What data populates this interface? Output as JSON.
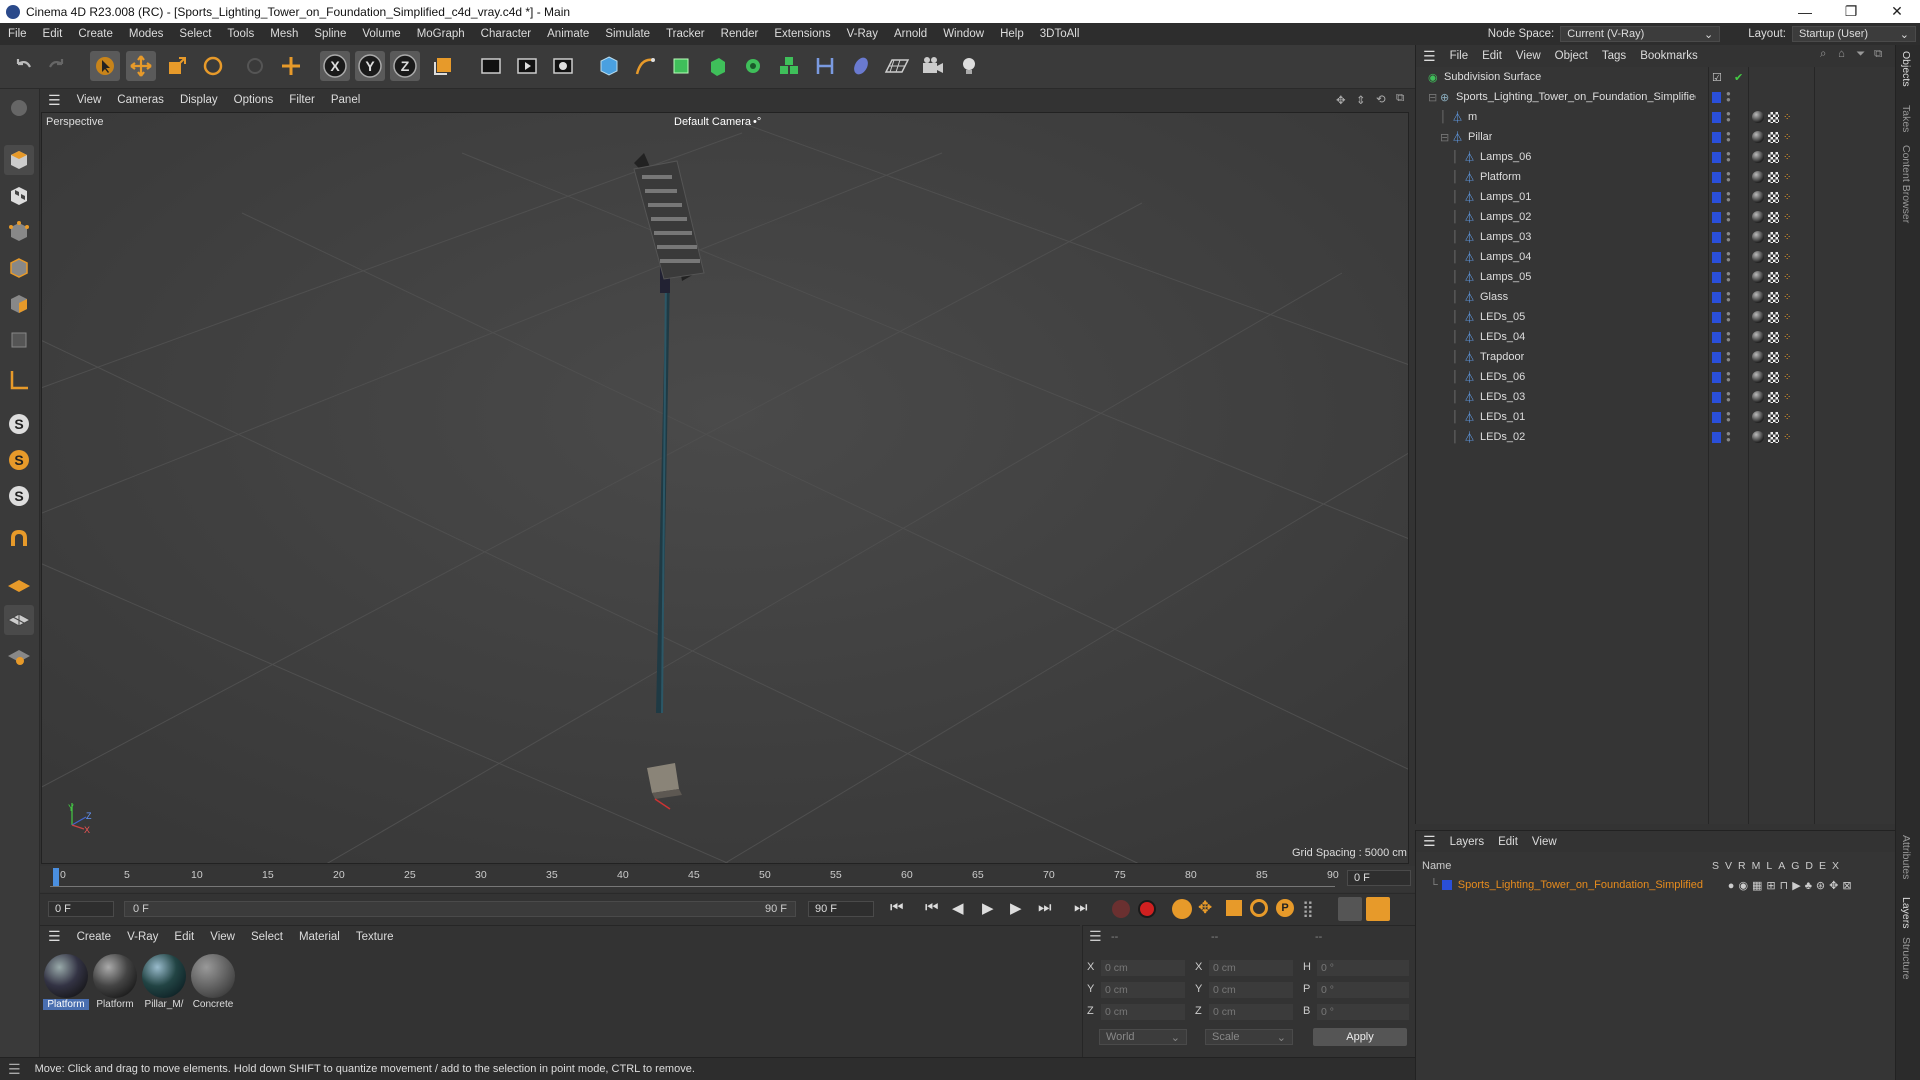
{
  "window": {
    "title": "Cinema 4D R23.008 (RC) - [Sports_Lighting_Tower_on_Foundation_Simplified_c4d_vray.c4d *] - Main",
    "minimize": "—",
    "maximize": "❐",
    "close": "✕"
  },
  "menubar": {
    "items": [
      "File",
      "Edit",
      "Create",
      "Modes",
      "Select",
      "Tools",
      "Mesh",
      "Spline",
      "Volume",
      "MoGraph",
      "Character",
      "Animate",
      "Simulate",
      "Tracker",
      "Render",
      "Extensions",
      "V-Ray",
      "Arnold",
      "Window",
      "Help",
      "3DToAll"
    ],
    "node_space_label": "Node Space:",
    "node_space_value": "Current (V-Ray)",
    "layout_label": "Layout:",
    "layout_value": "Startup (User)"
  },
  "viewport": {
    "menu": [
      "View",
      "Cameras",
      "Display",
      "Options",
      "Filter",
      "Panel"
    ],
    "view_name": "Perspective",
    "camera": "Default Camera",
    "camera_suffix": "•°",
    "grid_spacing": "Grid Spacing : 5000 cm",
    "axis_y": "Y",
    "axis_z": "Z",
    "axis_x": "X"
  },
  "timeline": {
    "ticks": [
      "0",
      "5",
      "10",
      "15",
      "20",
      "25",
      "30",
      "35",
      "40",
      "45",
      "50",
      "55",
      "60",
      "65",
      "70",
      "75",
      "80",
      "85",
      "90"
    ],
    "current_frame": "0 F",
    "start_field": "0 F",
    "range_start": "0 F",
    "range_end": "90 F",
    "end_field": "90 F"
  },
  "material_manager": {
    "menu": [
      "Create",
      "V-Ray",
      "Edit",
      "View",
      "Select",
      "Material",
      "Texture"
    ],
    "materials": [
      {
        "name": "Platform",
        "selected": true
      },
      {
        "name": "Platform",
        "selected": false
      },
      {
        "name": "Pillar_M/",
        "selected": false
      },
      {
        "name": "Concrete",
        "selected": false
      }
    ]
  },
  "coordinates": {
    "headers": [
      "--",
      "--",
      "--"
    ],
    "rows": [
      {
        "l1": "X",
        "v1": "0 cm",
        "l2": "X",
        "v2": "0 cm",
        "l3": "H",
        "v3": "0 °"
      },
      {
        "l1": "Y",
        "v1": "0 cm",
        "l2": "Y",
        "v2": "0 cm",
        "l3": "P",
        "v3": "0 °"
      },
      {
        "l1": "Z",
        "v1": "0 cm",
        "l2": "Z",
        "v2": "0 cm",
        "l3": "B",
        "v3": "0 °"
      }
    ],
    "mode1": "World",
    "mode2": "Scale",
    "apply": "Apply"
  },
  "status": "Move: Click and drag to move elements. Hold down SHIFT to quantize movement / add to the selection in point mode, CTRL to remove.",
  "object_manager": {
    "menu": [
      "File",
      "Edit",
      "View",
      "Object",
      "Tags",
      "Bookmarks"
    ],
    "objects": [
      {
        "name": "Subdivision Surface",
        "indent": 0,
        "type": "subdiv"
      },
      {
        "name": "Sports_Lighting_Tower_on_Foundation_Simplified",
        "indent": 1,
        "type": "null"
      },
      {
        "name": "m",
        "indent": 2,
        "type": "poly"
      },
      {
        "name": "Pillar",
        "indent": 2,
        "type": "poly"
      },
      {
        "name": "Lamps_06",
        "indent": 3,
        "type": "poly"
      },
      {
        "name": "Platform",
        "indent": 3,
        "type": "poly"
      },
      {
        "name": "Lamps_01",
        "indent": 3,
        "type": "poly"
      },
      {
        "name": "Lamps_02",
        "indent": 3,
        "type": "poly"
      },
      {
        "name": "Lamps_03",
        "indent": 3,
        "type": "poly"
      },
      {
        "name": "Lamps_04",
        "indent": 3,
        "type": "poly"
      },
      {
        "name": "Lamps_05",
        "indent": 3,
        "type": "poly"
      },
      {
        "name": "Glass",
        "indent": 3,
        "type": "poly"
      },
      {
        "name": "LEDs_05",
        "indent": 3,
        "type": "poly"
      },
      {
        "name": "LEDs_04",
        "indent": 3,
        "type": "poly"
      },
      {
        "name": "Trapdoor",
        "indent": 3,
        "type": "poly"
      },
      {
        "name": "LEDs_06",
        "indent": 3,
        "type": "poly"
      },
      {
        "name": "LEDs_03",
        "indent": 3,
        "type": "poly"
      },
      {
        "name": "LEDs_01",
        "indent": 3,
        "type": "poly"
      },
      {
        "name": "LEDs_02",
        "indent": 3,
        "type": "poly"
      }
    ]
  },
  "layers": {
    "menu": [
      "Layers",
      "Edit",
      "View"
    ],
    "header_name": "Name",
    "header_flags": [
      "S",
      "V",
      "R",
      "M",
      "L",
      "A",
      "G",
      "D",
      "E",
      "X"
    ],
    "rows": [
      {
        "name": "Sports_Lighting_Tower_on_Foundation_Simplified"
      }
    ]
  },
  "right_tabs": [
    "Objects",
    "Takes",
    "Content Browser",
    "Attributes",
    "Layers",
    "Structure"
  ],
  "colors": {
    "accent": "#e78c1e",
    "layer_blue": "#2a4fd8",
    "selection": "#4a6fb0"
  }
}
